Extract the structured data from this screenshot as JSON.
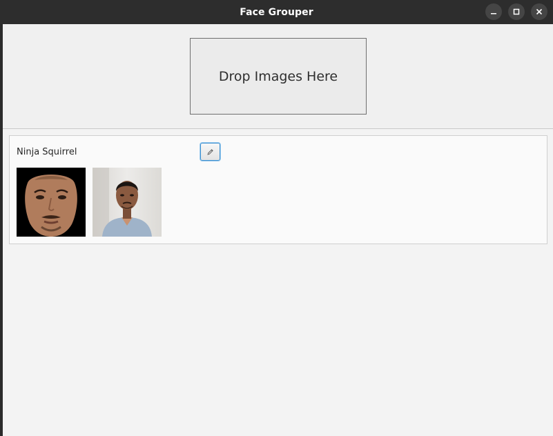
{
  "window": {
    "title": "Face Grouper"
  },
  "drop_zone": {
    "label": "Drop Images Here"
  },
  "groups": [
    {
      "name": "Ninja Squirrel",
      "edit_icon": "pencil-icon",
      "thumbnails": [
        "face-crop-thumbnail",
        "person-photo-thumbnail"
      ]
    }
  ],
  "colors": {
    "titlebar": "#2d2d2d",
    "accent": "#3a8fd0",
    "background": "#f3f3f3"
  }
}
